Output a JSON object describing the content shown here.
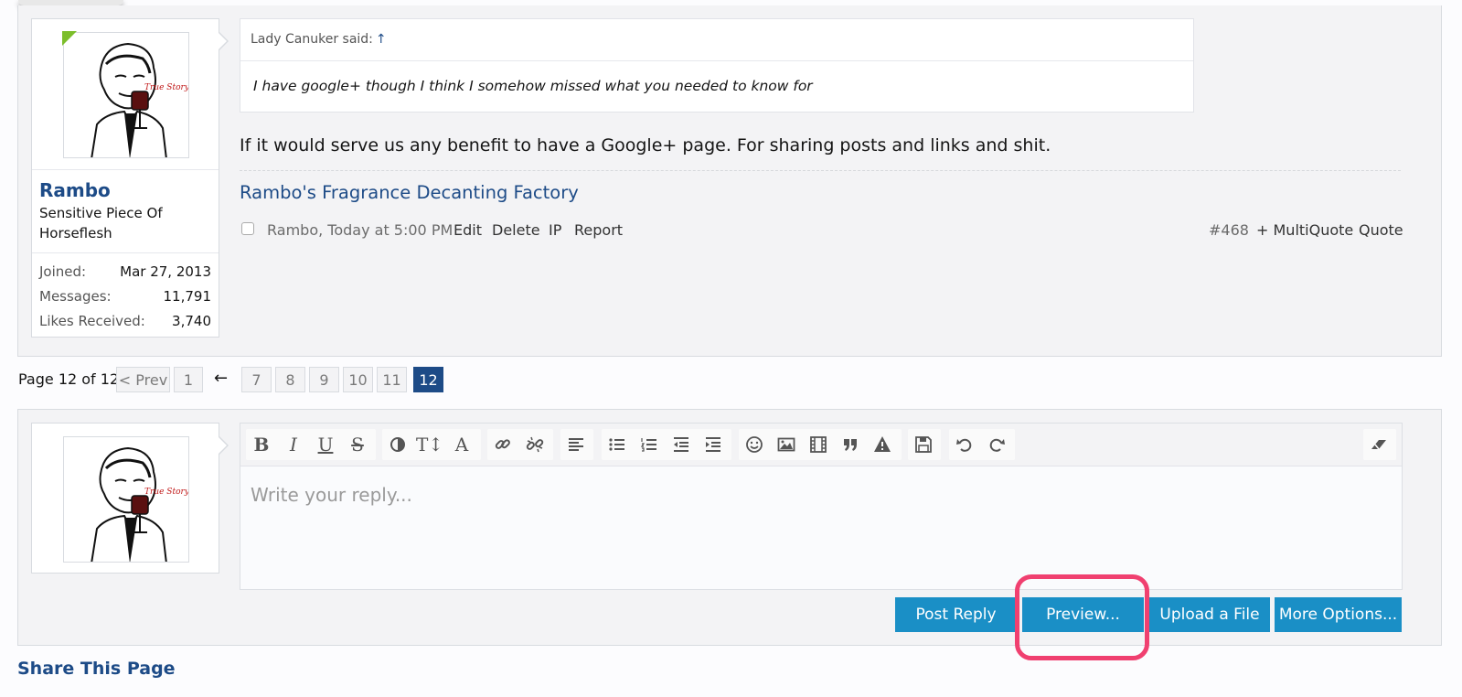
{
  "post": {
    "user": {
      "name": "Rambo",
      "title": "Sensitive Piece Of Horseflesh",
      "stats": [
        {
          "label": "Joined:",
          "value": "Mar 27, 2013"
        },
        {
          "label": "Messages:",
          "value": "11,791"
        },
        {
          "label": "Likes Received:",
          "value": "3,740"
        }
      ],
      "avatar_icon": "meme-avatar-icon",
      "avatar_caption": "True Story"
    },
    "quote": {
      "attribution": "Lady Canuker said:",
      "jump_arrow": "↑",
      "text": "I have google+ though I think I somehow missed what you needed to know for"
    },
    "body": "If it would serve us any benefit to have a Google+ page. For sharing posts and links and shit.",
    "signature": "Rambo's Fragrance Decanting Factory",
    "meta": {
      "author_time": "Rambo, Today at 5:00 PM",
      "edit": "Edit",
      "delete": "Delete",
      "ip": "IP",
      "report": "Report",
      "post_number": "#468",
      "multiquote": "+ MultiQuote",
      "quote": "Quote"
    }
  },
  "pagination": {
    "label": "Page 12 of 12",
    "prev": "< Prev",
    "first": "1",
    "gap": "←",
    "pages": [
      "7",
      "8",
      "9",
      "10",
      "11"
    ],
    "current": "12"
  },
  "reply": {
    "placeholder": "Write your reply...",
    "toolbar_icons": [
      "bold-icon",
      "italic-icon",
      "underline-icon",
      "strikethrough-icon",
      "text-color-icon",
      "font-size-icon",
      "font-family-icon",
      "link-icon",
      "unlink-icon",
      "align-icon",
      "bullet-list-icon",
      "numbered-list-icon",
      "outdent-icon",
      "indent-icon",
      "smilie-icon",
      "image-icon",
      "media-icon",
      "quote-icon",
      "spoiler-icon",
      "save-draft-icon",
      "undo-icon",
      "redo-icon",
      "remove-formatting-icon"
    ],
    "buttons": {
      "post_reply": "Post Reply",
      "preview": "Preview...",
      "upload": "Upload a File",
      "more_options": "More Options..."
    }
  },
  "share_title": "Share This Page",
  "colors": {
    "link": "#1d4b87",
    "button": "#1a8fc6",
    "highlight": "#f04070",
    "online": "#7cbe2b"
  }
}
